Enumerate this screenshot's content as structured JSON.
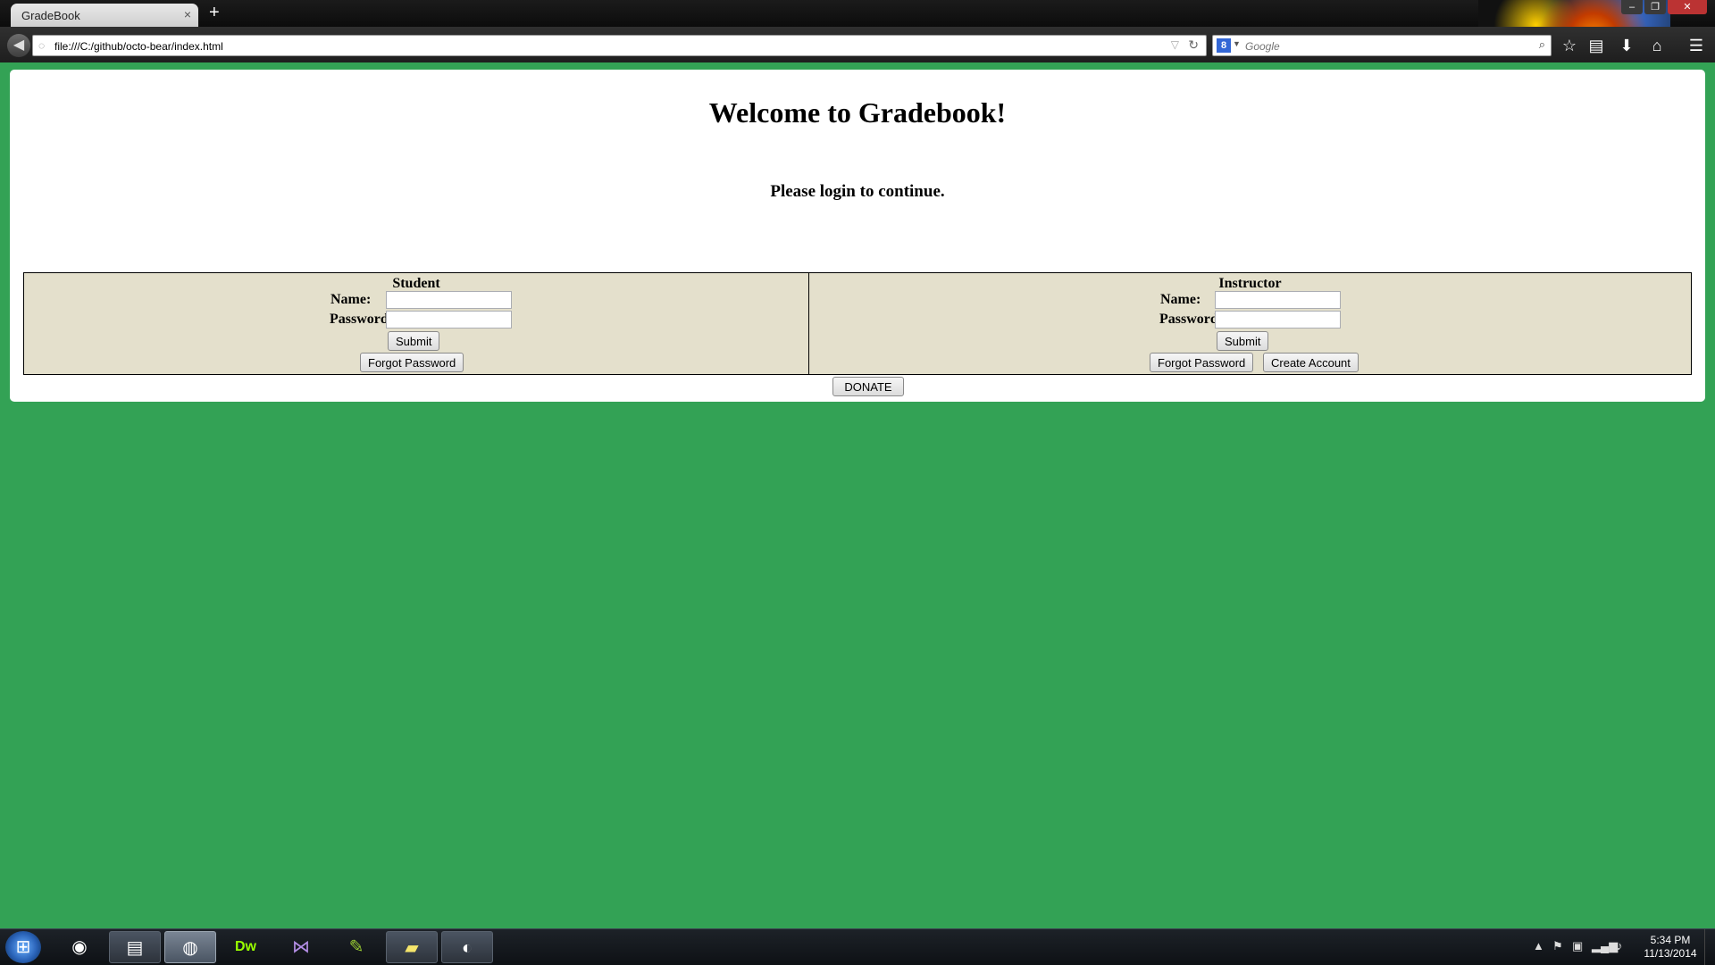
{
  "browser": {
    "tab_title": "GradeBook",
    "tab_close": "×",
    "new_tab": "+",
    "url": "file:///C:/github/octo-bear/index.html",
    "search_placeholder": "Google",
    "search_engine_letter": "8",
    "window_controls": [
      "–",
      "❐",
      "✕"
    ]
  },
  "page": {
    "heading": "Welcome to Gradebook!",
    "subheading": "Please login to continue.",
    "student": {
      "title": "Student",
      "name_label": "Name:",
      "password_label": "Password:",
      "submit_label": "Submit",
      "forgot_label": "Forgot Password"
    },
    "instructor": {
      "title": "Instructor",
      "name_label": "Name:",
      "password_label": "Password:",
      "submit_label": "Submit",
      "forgot_label": "Forgot Password",
      "create_label": "Create Account"
    },
    "donate_label": "DONATE"
  },
  "taskbar": {
    "apps": [
      {
        "name": "chrome",
        "glyph": "◉"
      },
      {
        "name": "explorer",
        "glyph": "▤"
      },
      {
        "name": "firefox",
        "glyph": "◍"
      },
      {
        "name": "dreamweaver",
        "glyph": "Dw"
      },
      {
        "name": "visual-studio",
        "glyph": "⋈"
      },
      {
        "name": "notepad",
        "glyph": "✎"
      },
      {
        "name": "sticky-notes",
        "glyph": "▰"
      },
      {
        "name": "other-app",
        "glyph": "◐"
      }
    ],
    "clock_time": "5:34 PM",
    "clock_date": "11/13/2014"
  },
  "colors": {
    "page_background": "#33a255",
    "table_background": "#e4e0cc"
  }
}
